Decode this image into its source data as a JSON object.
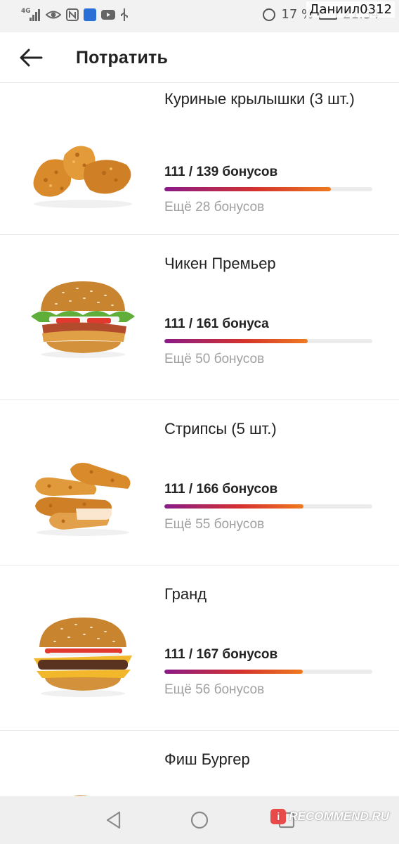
{
  "status_bar": {
    "network": "4G",
    "battery_percent": "17 %",
    "time": "21:34",
    "watermark_user": "Даниил0312"
  },
  "header": {
    "title": "Потратить",
    "back_icon": "arrow-left-icon"
  },
  "rewards": [
    {
      "name": "Куриные крылышки (3 шт.)",
      "progress_text": "111 / 139 бонусов",
      "current": 111,
      "required": 139,
      "remaining_text": "Ещё 28 бонусов",
      "image": "chicken-wings"
    },
    {
      "name": "Чикен Премьер",
      "progress_text": "111 / 161 бонуса",
      "current": 111,
      "required": 161,
      "remaining_text": "Ещё 50 бонусов",
      "image": "chicken-burger"
    },
    {
      "name": "Стрипсы (5 шт.)",
      "progress_text": "111 / 166 бонусов",
      "current": 111,
      "required": 166,
      "remaining_text": "Ещё 55 бонусов",
      "image": "chicken-strips"
    },
    {
      "name": "Гранд",
      "progress_text": "111 / 167 бонусов",
      "current": 111,
      "required": 167,
      "remaining_text": "Ещё 56 бонусов",
      "image": "beef-burger"
    },
    {
      "name": "Фиш Бургер",
      "image": "fish-burger"
    }
  ],
  "colors": {
    "progress_start": "#8a1a88",
    "progress_mid": "#d4322e",
    "progress_end": "#ef7a1f",
    "track": "#ececec",
    "muted_text": "#a0a0a0"
  },
  "footer": {
    "watermark": "RECOMMEND.RU",
    "logo_letter": "i"
  }
}
